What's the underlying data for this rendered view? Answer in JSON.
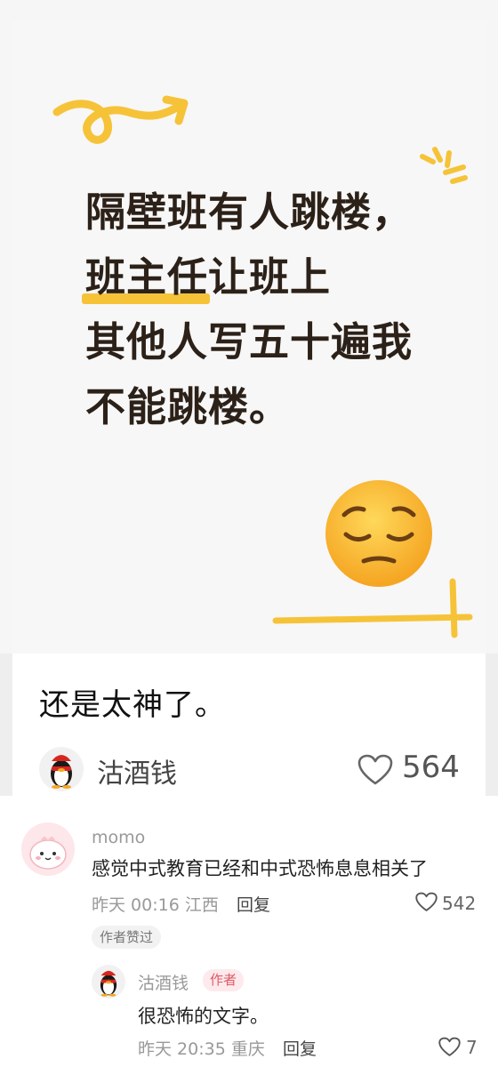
{
  "cover": {
    "headline_lines": [
      {
        "plain": "隔壁班有人跳楼，"
      },
      {
        "mark": "班主任",
        "rest": "让班上"
      },
      {
        "plain": "其他人写五十遍我"
      },
      {
        "plain": "不能跳楼。"
      }
    ],
    "emoji": "pensive-face",
    "accent_color": "#f6c338"
  },
  "post": {
    "text": "还是太神了。",
    "author": "沽酒钱",
    "likes": "564"
  },
  "comments": [
    {
      "user": "momo",
      "text": "感觉中式教育已经和中式恐怖息息相关了",
      "meta": "昨天 00:16 江西",
      "reply_label": "回复",
      "likes": "542",
      "badge": "作者赞过",
      "replies": [
        {
          "user": "沽酒钱",
          "tag": "作者",
          "text": "很恐怖的文字。",
          "meta": "昨天 20:35 重庆",
          "reply_label": "回复",
          "likes": "7"
        }
      ]
    }
  ]
}
